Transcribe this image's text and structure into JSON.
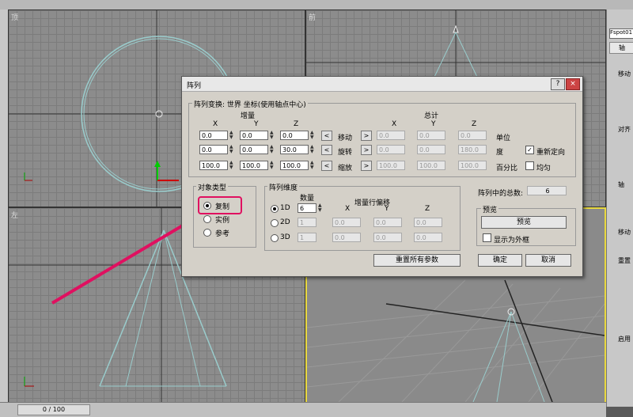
{
  "viewports": {
    "top_label": "顶",
    "front_label": "前",
    "left_label": "左"
  },
  "right_panel": {
    "name_field": "Fspot01",
    "tab": "轴",
    "labels": [
      "移动",
      "对齐",
      "轴",
      "移动",
      "重置",
      "启用"
    ]
  },
  "statusbar": {
    "frame": "0 / 100"
  },
  "dialog": {
    "title": "阵列",
    "help": "?",
    "close": "×",
    "transform_group": {
      "legend": "阵列变换: 世界 坐标(使用轴点中心)",
      "increment_header": "增量",
      "total_header": "总计",
      "axis_x": "X",
      "axis_y": "Y",
      "axis_z": "Z",
      "rows": [
        {
          "label": "移动",
          "inc": [
            "0.0",
            "0.0",
            "0.0"
          ],
          "tot": [
            "0.0",
            "0.0",
            "0.0"
          ],
          "unit": "单位"
        },
        {
          "label": "旋转",
          "inc": [
            "0.0",
            "0.0",
            "30.0"
          ],
          "tot": [
            "0.0",
            "0.0",
            "180.0"
          ],
          "unit": "度"
        },
        {
          "label": "缩放",
          "inc": [
            "100.0",
            "100.0",
            "100.0"
          ],
          "tot": [
            "100.0",
            "100.0",
            "100.0"
          ],
          "unit": "百分比"
        }
      ],
      "reorient_label": "重新定向",
      "reorient_checked": true,
      "uniform_label": "均匀",
      "uniform_checked": false
    },
    "object_type": {
      "legend": "对象类型",
      "options": [
        "复制",
        "实例",
        "参考"
      ],
      "selected": "复制"
    },
    "dimensions": {
      "legend": "阵列维度",
      "count_header": "数量",
      "offset_header": "增量行偏移",
      "axis_x": "X",
      "axis_y": "Y",
      "axis_z": "Z",
      "rows": [
        {
          "label": "1D",
          "count": "6",
          "offsets": []
        },
        {
          "label": "2D",
          "count": "1",
          "offsets": [
            "0.0",
            "0.0",
            "0.0"
          ]
        },
        {
          "label": "3D",
          "count": "1",
          "offsets": [
            "0.0",
            "0.0",
            "0.0"
          ]
        }
      ],
      "selected": "1D"
    },
    "total_label": "阵列中的总数:",
    "total_value": "6",
    "preview_group": {
      "legend": "预览",
      "button": "预览",
      "box_label": "显示为外框"
    },
    "reset_button": "重置所有参数",
    "ok_button": "确定",
    "cancel_button": "取消"
  }
}
